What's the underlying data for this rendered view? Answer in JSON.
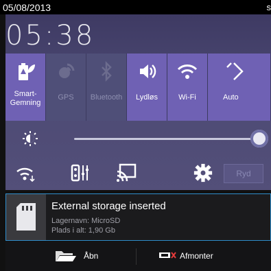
{
  "status_bar": {
    "date": "05/08/2013",
    "edge_glyph": "s"
  },
  "clock": {
    "time": "05:38"
  },
  "toggles": [
    {
      "label": "Smart-\nGemning",
      "icon": "battery-leaf-icon",
      "state": "on"
    },
    {
      "label": "GPS",
      "icon": "gps-icon",
      "state": "off"
    },
    {
      "label": "Bluetooth",
      "icon": "bluetooth-icon",
      "state": "off"
    },
    {
      "label": "Lydløs",
      "icon": "speaker-icon",
      "state": "on"
    },
    {
      "label": "Wi-Fi",
      "icon": "wifi-icon",
      "state": "on"
    },
    {
      "label": "Auto",
      "icon": "auto-rotate-icon",
      "state": "on"
    }
  ],
  "brightness": {
    "icon": "brightness-icon",
    "level": 1.0
  },
  "quick_actions": {
    "icons": [
      "wifi-sync-icon",
      "equalizer-icon",
      "cast-screen-icon",
      "settings-gear-icon"
    ],
    "clear_label": "Ryd"
  },
  "notification": {
    "icon": "sd-card-icon",
    "title": "External storage inserted",
    "line1": "Lagernavn: MicroSD",
    "line2": "Plads i alt: 1,90 Gb"
  },
  "actions": {
    "open_label": "Åbn",
    "unmount_label": "Afmonter"
  },
  "colors": {
    "accent": "#6f61b4",
    "panel": "#4d4a74",
    "highlight_border": "#2f8ecc"
  }
}
